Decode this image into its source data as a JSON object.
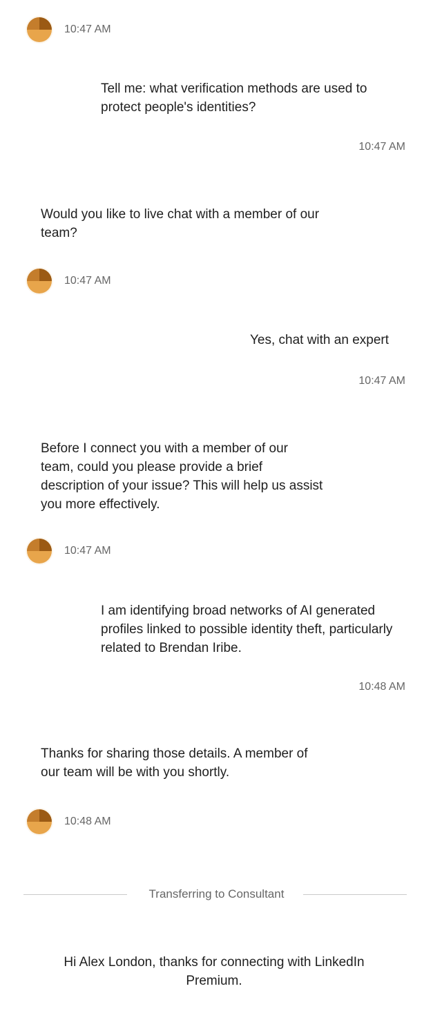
{
  "messages": [
    {
      "role": "bot",
      "time": "10:47 AM"
    },
    {
      "role": "user",
      "text": "Tell me: what verification methods are used to protect people's identities?",
      "time": "10:47 AM"
    },
    {
      "role": "bot",
      "text": "Would you like to live chat with a member of our team?",
      "time": "10:47 AM"
    },
    {
      "role": "user",
      "text": "Yes, chat with an expert",
      "time": "10:47 AM"
    },
    {
      "role": "bot",
      "text": "Before I connect you with a member of our team, could you please provide a brief description of your issue? This will help us assist you more effectively.",
      "time": "10:47 AM"
    },
    {
      "role": "user",
      "text": "I am identifying broad networks of AI generated profiles linked to possible identity theft, particularly related to Brendan Iribe.",
      "time": "10:48 AM"
    },
    {
      "role": "bot",
      "text": "Thanks for sharing those details. A member of our team will be with you shortly.",
      "time": "10:48 AM"
    }
  ],
  "transfer": {
    "text": "Transferring to Consultant"
  },
  "agent": {
    "greeting": "Hi Alex London, thanks for connecting with LinkedIn Premium."
  },
  "avatar": {
    "icon": "bot-avatar-icon",
    "colors": {
      "light": "#e8a54b",
      "dark": "#9b5a14"
    }
  }
}
